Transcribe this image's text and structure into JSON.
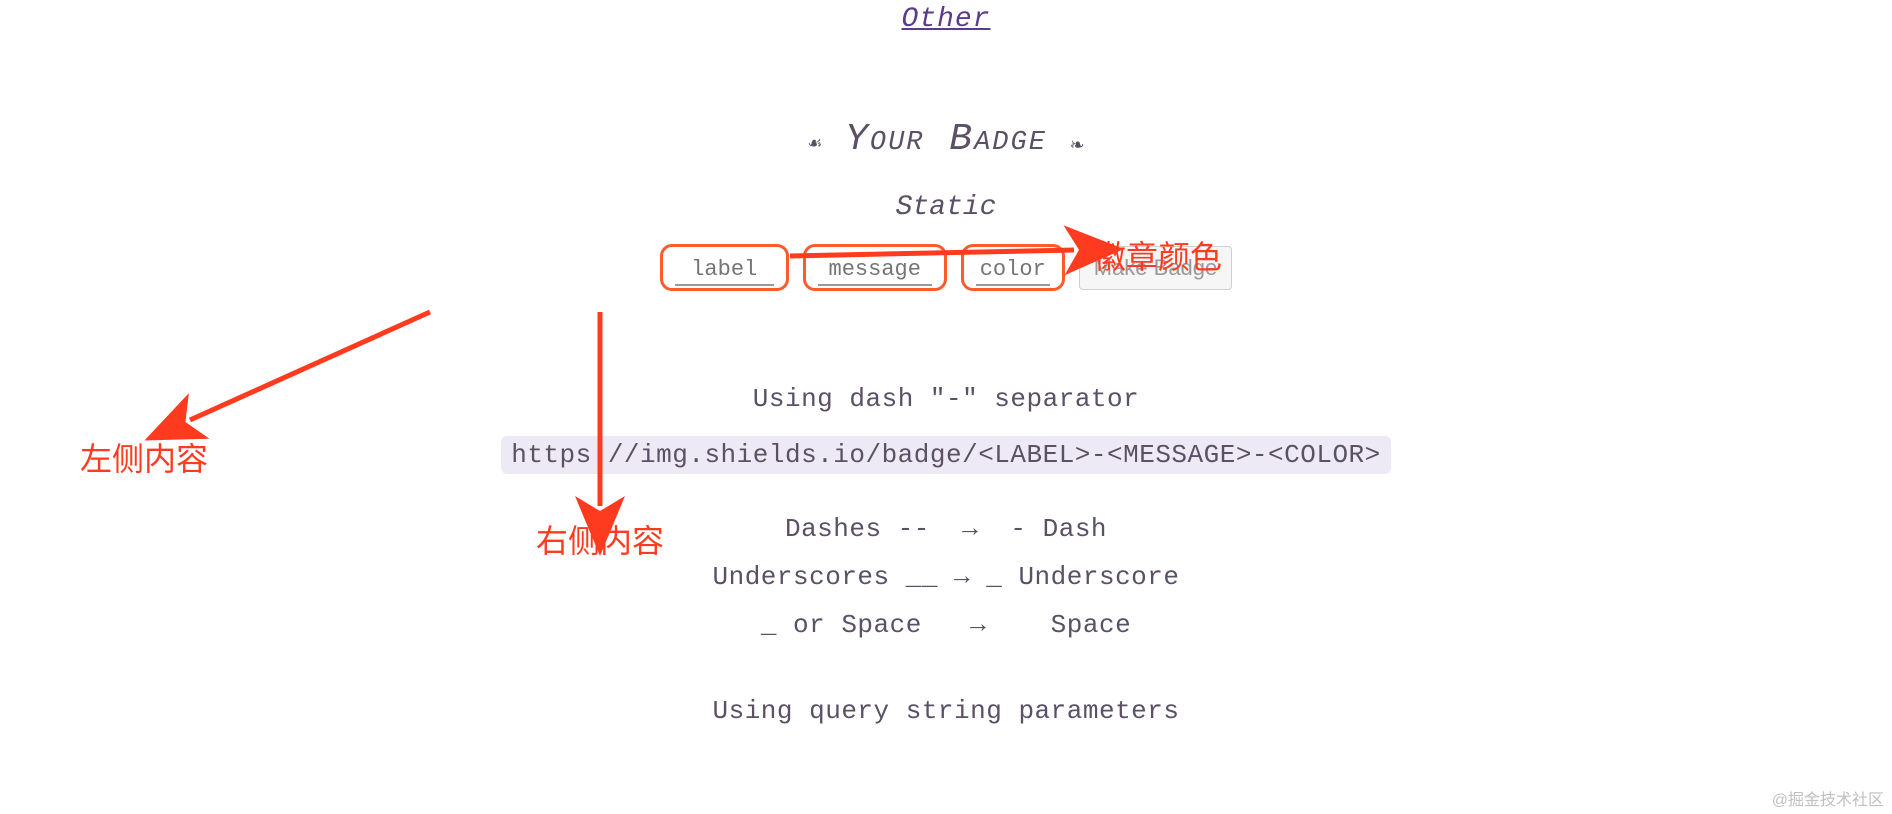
{
  "nav": {
    "other": "Other"
  },
  "heading": "Your Badge",
  "subheading": "Static",
  "inputs": {
    "label_placeholder": "label",
    "message_placeholder": "message",
    "color_placeholder": "color"
  },
  "make_button": "Make Badge",
  "dash_sep_text": "Using dash \"-\" separator",
  "url_template": "https://img.shields.io/badge/<LABEL>-<MESSAGE>-<COLOR>",
  "mappings": {
    "row1": "Dashes --  →  - Dash",
    "row2": "Underscores __ → _ Underscore",
    "row3": "_ or Space   →    Space"
  },
  "query_line": "Using query string parameters",
  "annotations": {
    "left": "左侧内容",
    "right_content": "右侧内容",
    "badge_color": "徽章颜色"
  },
  "watermark": "@掘金技术社区"
}
